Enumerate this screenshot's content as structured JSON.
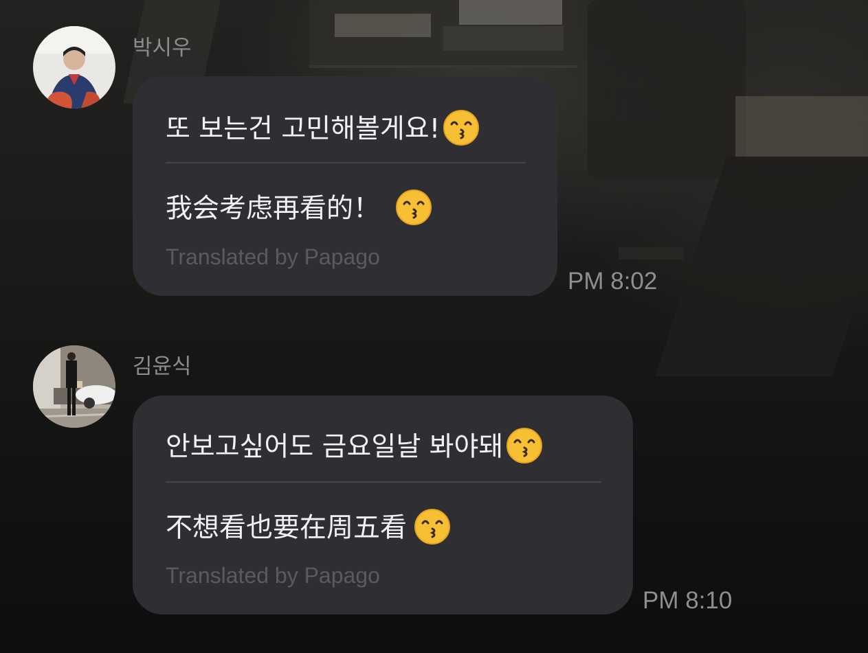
{
  "messages": [
    {
      "sender": "박시우",
      "original": "또 보는건 고민해볼게요!",
      "translation": "我会考虑再看的！",
      "translated_by": "Translated by Papago",
      "time": "PM 8:02",
      "emoji": "kissing-face-smiling-eyes-icon"
    },
    {
      "sender": "김윤식",
      "original": "안보고싶어도 금요일날 봐야돼",
      "translation": "不想看也要在周五看",
      "translated_by": "Translated by Papago",
      "time": "PM 8:10",
      "emoji": "kissing-face-smiling-eyes-icon"
    }
  ],
  "colors": {
    "bubble": "#2f2f33",
    "text": "#f2f2f4",
    "meta": "#8e8e93",
    "emoji": "#f7c034"
  }
}
